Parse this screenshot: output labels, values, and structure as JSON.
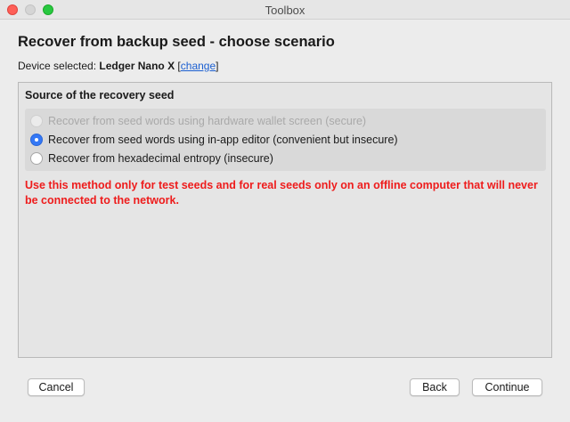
{
  "window": {
    "title": "Toolbox"
  },
  "header": {
    "title": "Recover from backup seed - choose scenario",
    "device_label": "Device selected:",
    "device_name": "Ledger Nano X",
    "change_link": "change"
  },
  "panel": {
    "title": "Source of the recovery seed",
    "options": [
      {
        "label": "Recover from seed words using hardware wallet screen (secure)",
        "state": "disabled"
      },
      {
        "label": "Recover from seed words using in-app editor (convenient but insecure)",
        "state": "selected"
      },
      {
        "label": "Recover from hexadecimal entropy (insecure)",
        "state": "unselected"
      }
    ],
    "warning": "Use this method only for test seeds and for real seeds only on an offline computer that will never be connected to the network."
  },
  "footer": {
    "cancel_label": "Cancel",
    "back_label": "Back",
    "continue_label": "Continue"
  },
  "colors": {
    "accent": "#3478f6",
    "warning": "#ee1c1c",
    "link": "#1b5fd1"
  }
}
